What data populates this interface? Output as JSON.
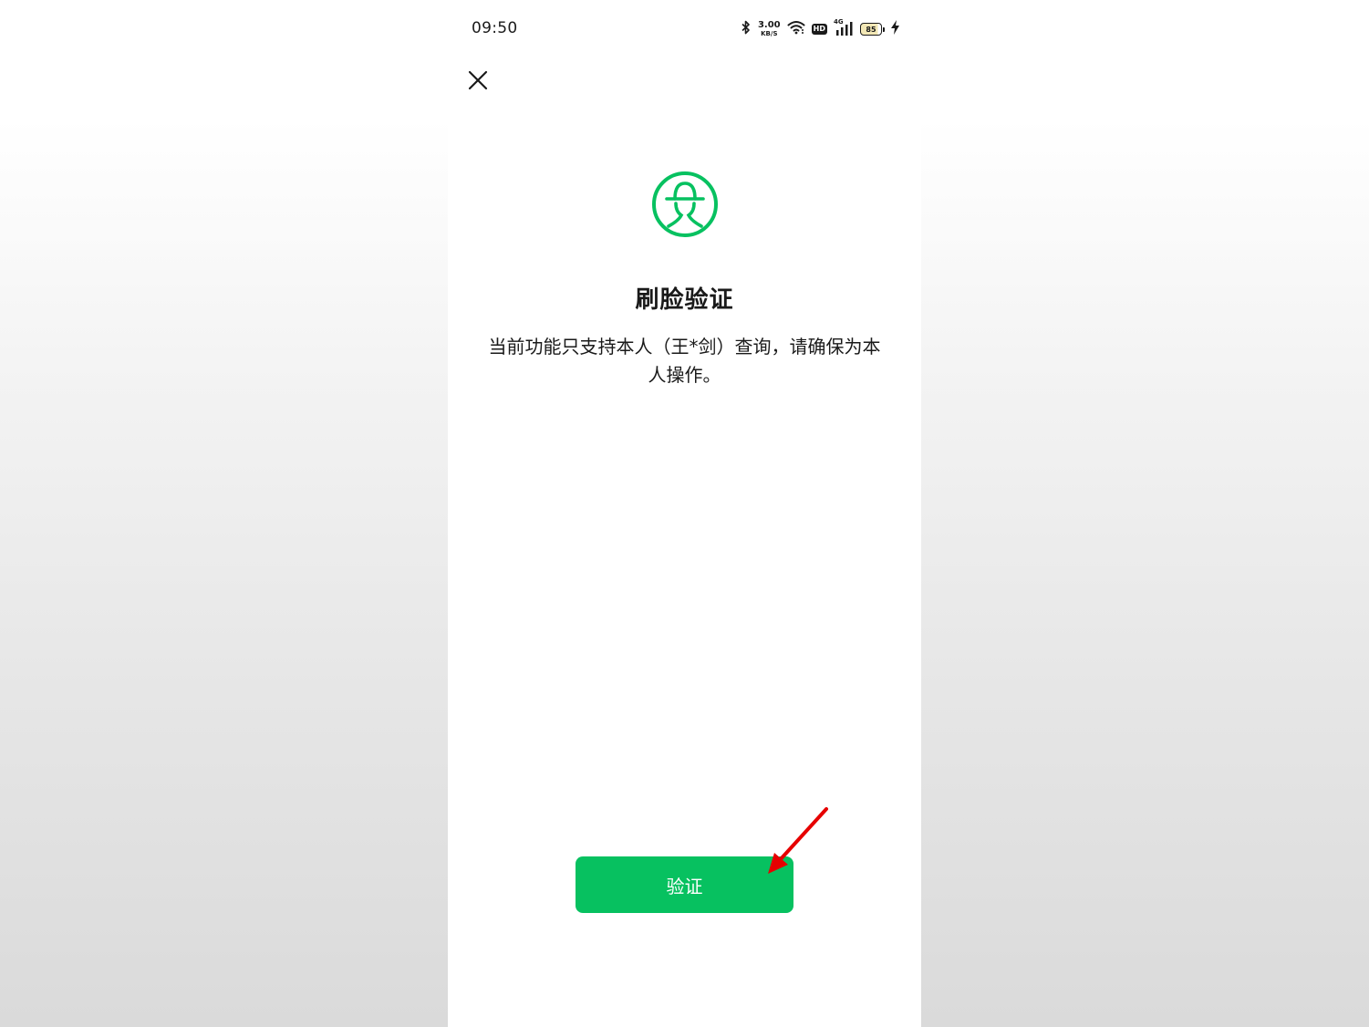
{
  "status_bar": {
    "time": "09:50",
    "net_speed_value": "3.00",
    "net_speed_unit": "KB/S",
    "hd_label": "HD",
    "network_type": "4G",
    "battery_level": "85"
  },
  "icons": {
    "close": "close-icon",
    "face": "face-recognition-icon",
    "bluetooth": "bluetooth-icon",
    "wifi": "wifi-icon",
    "signal": "signal-icon",
    "battery": "battery-icon",
    "charging": "charging-icon",
    "annotation": "red-arrow-annotation"
  },
  "main": {
    "title": "刷脸验证",
    "description": "当前功能只支持本人（王*剑）查询，请确保为本人操作。",
    "verify_button_label": "验证"
  },
  "colors": {
    "accent": "#07c160",
    "annotation_arrow": "#e60000"
  }
}
